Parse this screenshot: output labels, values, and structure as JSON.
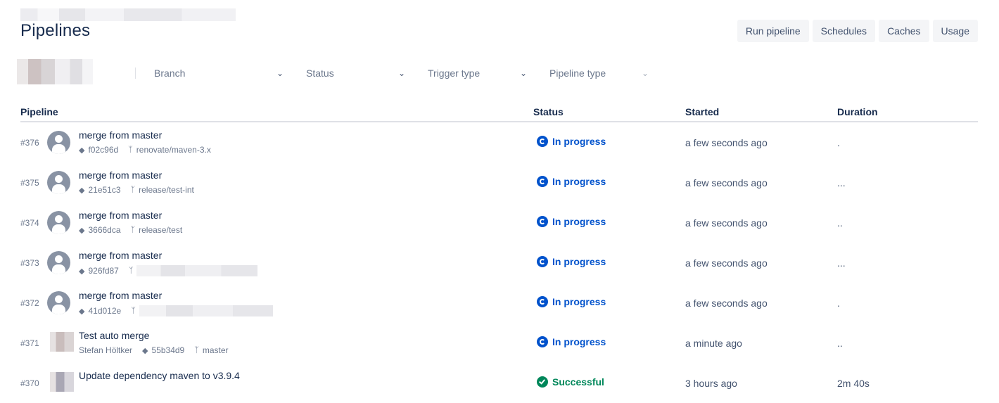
{
  "page": {
    "title": "Pipelines"
  },
  "toolbar": {
    "run_label": "Run pipeline",
    "schedules_label": "Schedules",
    "caches_label": "Caches",
    "usage_label": "Usage"
  },
  "filters": {
    "branch": "Branch",
    "status": "Status",
    "trigger": "Trigger type",
    "pipeline_type": "Pipeline type"
  },
  "table": {
    "headers": {
      "pipeline": "Pipeline",
      "status": "Status",
      "started": "Started",
      "duration": "Duration"
    },
    "rows": [
      {
        "num": "#376",
        "title": "merge from master",
        "author": "",
        "commit": "f02c96d",
        "branch": "renovate/maven-3.x",
        "status": "In progress",
        "started": "a few seconds ago",
        "duration": "."
      },
      {
        "num": "#375",
        "title": "merge from master",
        "author": "",
        "commit": "21e51c3",
        "branch": "release/test-int",
        "status": "In progress",
        "started": "a few seconds ago",
        "duration": "..."
      },
      {
        "num": "#374",
        "title": "merge from master",
        "author": "",
        "commit": "3666dca",
        "branch": "release/test",
        "status": "In progress",
        "started": "a few seconds ago",
        "duration": ".."
      },
      {
        "num": "#373",
        "title": "merge from master",
        "author": "",
        "commit": "926fd87",
        "branch": "",
        "status": "In progress",
        "started": "a few seconds ago",
        "duration": "..."
      },
      {
        "num": "#372",
        "title": "merge from master",
        "author": "",
        "commit": "41d012e",
        "branch": "",
        "status": "In progress",
        "started": "a few seconds ago",
        "duration": "."
      },
      {
        "num": "#371",
        "title": "Test auto merge",
        "author": "Stefan Höltker",
        "commit": "55b34d9",
        "branch": "master",
        "status": "In progress",
        "started": "a minute ago",
        "duration": ".."
      },
      {
        "num": "#370",
        "title": "Update dependency maven to v3.9.4",
        "author": "",
        "commit": "",
        "branch": "",
        "status": "Successful",
        "started": "3 hours ago",
        "duration": "2m 40s"
      }
    ]
  },
  "colors": {
    "accent": "#0052cc",
    "success": "#00875a",
    "text": "#172b4d",
    "subtle": "#6b778c"
  }
}
